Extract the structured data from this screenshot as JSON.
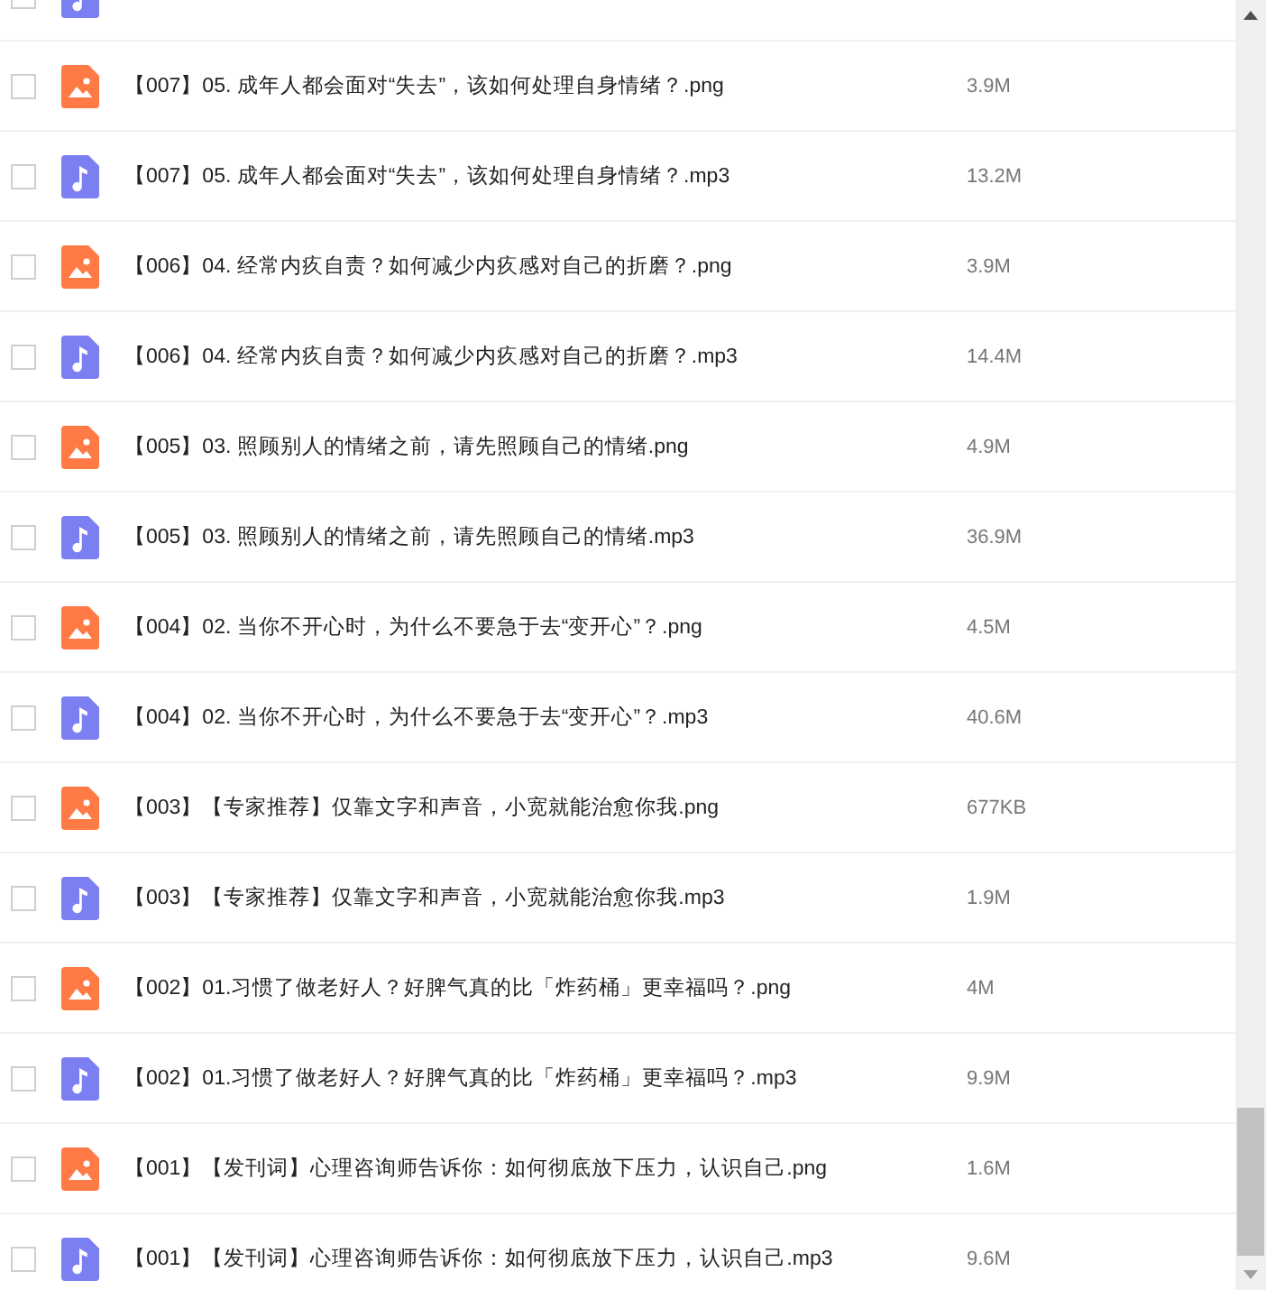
{
  "files": [
    {
      "kind": "audio",
      "checked": false
    },
    {
      "kind": "image",
      "checked": false,
      "name": "【007】05. 成年人都会面对“失去”，该如何处理自身情绪？.png",
      "size": "3.9M"
    },
    {
      "kind": "audio",
      "checked": false,
      "name": "【007】05. 成年人都会面对“失去”，该如何处理自身情绪？.mp3",
      "size": "13.2M"
    },
    {
      "kind": "image",
      "checked": false,
      "name": "【006】04. 经常内疚自责？如何减少内疚感对自己的折磨？.png",
      "size": "3.9M"
    },
    {
      "kind": "audio",
      "checked": false,
      "name": "【006】04. 经常内疚自责？如何减少内疚感对自己的折磨？.mp3",
      "size": "14.4M"
    },
    {
      "kind": "image",
      "checked": false,
      "name": "【005】03. 照顾别人的情绪之前，请先照顾自己的情绪.png",
      "size": "4.9M"
    },
    {
      "kind": "audio",
      "checked": false,
      "name": "【005】03. 照顾别人的情绪之前，请先照顾自己的情绪.mp3",
      "size": "36.9M"
    },
    {
      "kind": "image",
      "checked": false,
      "name": "【004】02. 当你不开心时，为什么不要急于去“变开心”？.png",
      "size": "4.5M"
    },
    {
      "kind": "audio",
      "checked": false,
      "name": "【004】02. 当你不开心时，为什么不要急于去“变开心”？.mp3",
      "size": "40.6M"
    },
    {
      "kind": "image",
      "checked": false,
      "name": "【003】【专家推荐】仅靠文字和声音，小宽就能治愈你我.png",
      "size": "677KB"
    },
    {
      "kind": "audio",
      "checked": false,
      "name": "【003】【专家推荐】仅靠文字和声音，小宽就能治愈你我.mp3",
      "size": "1.9M"
    },
    {
      "kind": "image",
      "checked": false,
      "name": "【002】01.习惯了做老好人？好脾气真的比「炸药桶」更幸福吗？.png",
      "size": "4M"
    },
    {
      "kind": "audio",
      "checked": false,
      "name": "【002】01.习惯了做老好人？好脾气真的比「炸药桶」更幸福吗？.mp3",
      "size": "9.9M"
    },
    {
      "kind": "image",
      "checked": false,
      "name": "【001】【发刊词】心理咨询师告诉你：如何彻底放下压力，认识自己.png",
      "size": "1.6M"
    },
    {
      "kind": "audio",
      "checked": false,
      "name": "【001】【发刊词】心理咨询师告诉你：如何彻底放下压力，认识自己.mp3",
      "size": "9.6M"
    }
  ]
}
